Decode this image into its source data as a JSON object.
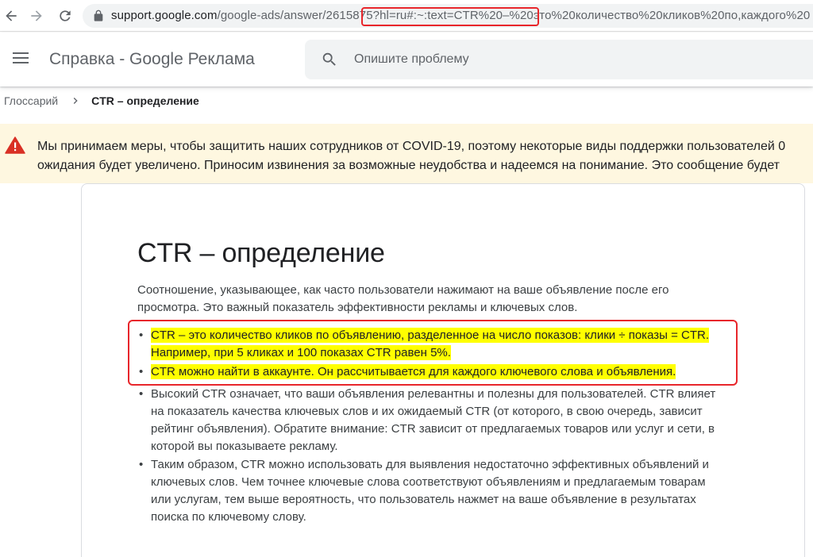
{
  "browser": {
    "url_host": "support.google.com",
    "url_path": "/google-ads/answer/2615875?hl=ru#:~:text=CTR%20–%20это%20количество%20кликов%20по,каждого%20"
  },
  "header": {
    "app_title": "Справка - Google Реклама",
    "search_placeholder": "Опишите проблему"
  },
  "breadcrumb": {
    "parent": "Глоссарий",
    "current": "CTR – определение"
  },
  "banner": {
    "line1": "Мы принимаем меры, чтобы защитить наших сотрудников от COVID-19, поэтому некоторые виды поддержки пользователей 0",
    "line2": "ожидания будет увеличено. Приносим извинения за возможные неудобства и надеемся на понимание. Это сообщение будет"
  },
  "article": {
    "title": "CTR – определение",
    "intro_line1": "Соотношение, указывающее, как часто пользователи нажимают на ваше объявление после его",
    "intro_line2": "просмотра. Это важный показатель эффективности рекламы и ключевых слов.",
    "bullets": [
      {
        "lines": [
          "CTR – это количество кликов по объявлению, разделенное на число показов: клики ÷ показы = CTR.",
          "Например, при 5 кликах и 100 показах CTR равен 5%."
        ],
        "highlighted": true
      },
      {
        "lines": [
          "CTR можно найти в аккаунте. Он рассчитывается для каждого ключевого слова и объявления."
        ],
        "highlighted": true
      },
      {
        "lines": [
          "Высокий CTR означает, что ваши объявления релевантны и полезны для пользователей. CTR влияет",
          "на показатель качества ключевых слов и их ожидаемый CTR (от которого, в свою очередь, зависит",
          "рейтинг объявления). Обратите внимание: CTR зависит от предлагаемых товаров или услуг и сети, в",
          "которой вы показываете рекламу."
        ],
        "highlighted": false
      },
      {
        "lines": [
          "Таким образом, CTR можно использовать для выявления недостаточно эффективных объявлений и",
          "ключевых слов. Чем точнее ключевые слова соответствуют объявлениям и предлагаемым товарам",
          "или услугам, тем выше вероятность, что пользователь нажмет на ваше объявление в результатах",
          "поиска по ключевому слову."
        ],
        "highlighted": false
      }
    ]
  },
  "colors": {
    "annotation_red": "#e8262b",
    "highlight_yellow": "#ffff00",
    "banner_bg": "#fef7e0",
    "warning_red": "#d93025"
  },
  "icons": [
    "back-arrow-icon",
    "forward-arrow-icon",
    "reload-icon",
    "lock-icon",
    "menu-icon",
    "search-icon",
    "chevron-right-icon",
    "warning-icon"
  ]
}
